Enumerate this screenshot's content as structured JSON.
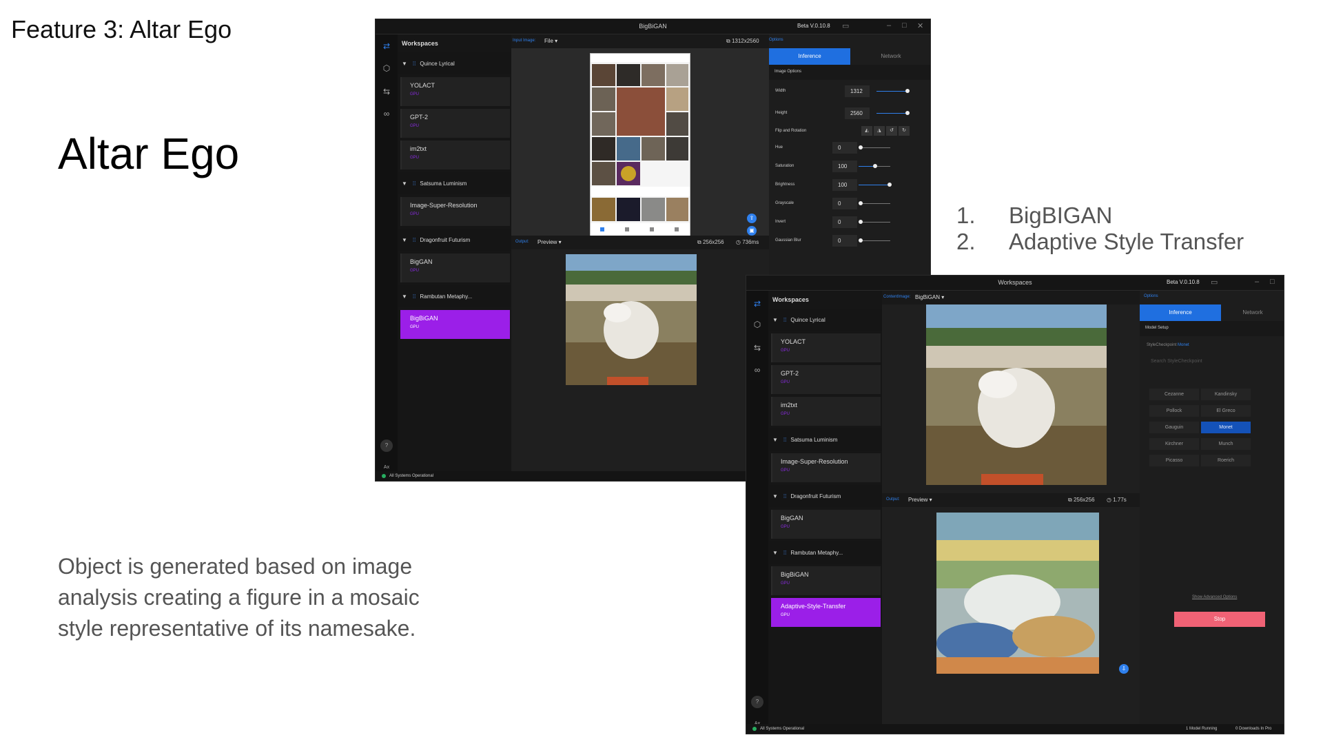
{
  "slide": {
    "feature": "Feature 3: Altar Ego",
    "title": "Altar Ego",
    "description": "Object is generated based on image analysis creating a figure in a mosaic style representative of its namesake.",
    "list": [
      {
        "num": "1.",
        "text": "BigBIGAN"
      },
      {
        "num": "2.",
        "text": "Adaptive Style Transfer"
      }
    ]
  },
  "win1": {
    "title": "BigBiGAN",
    "version": "Beta V.0.10.8",
    "workspaces_label": "Workspaces",
    "groups": [
      {
        "name": "Quince Lyrical",
        "items": [
          {
            "name": "YOLACT",
            "tag": "GPU"
          },
          {
            "name": "GPT-2",
            "tag": "GPU"
          },
          {
            "name": "im2txt",
            "tag": "GPU"
          }
        ]
      },
      {
        "name": "Satsuma Luminism",
        "items": [
          {
            "name": "Image-Super-Resolution",
            "tag": "GPU"
          }
        ]
      },
      {
        "name": "Dragonfruit Futurism",
        "items": [
          {
            "name": "BigGAN",
            "tag": "GPU"
          }
        ]
      },
      {
        "name": "Rambutan Metaphy...",
        "items": [
          {
            "name": "BigBiGAN",
            "tag": "GPU"
          }
        ]
      }
    ],
    "input_label": "Input Image:",
    "input_dd": "File",
    "input_dim": "1312x2560",
    "output_label": "Output:",
    "output_dd": "Preview",
    "output_dim": "256x256",
    "output_time": "736ms",
    "options_label": "Options",
    "tab_inference": "Inference",
    "tab_network": "Network",
    "section": "Image Options",
    "width_label": "Width",
    "width_value": "1312",
    "height_label": "Height",
    "height_value": "2560",
    "flip_label": "Flip and Rotation",
    "params": [
      {
        "label": "Hue",
        "value": "0",
        "level": 0
      },
      {
        "label": "Saturation",
        "value": "100",
        "level": 0.5
      },
      {
        "label": "Brightness",
        "value": "100",
        "level": 1
      },
      {
        "label": "Grayscale",
        "value": "0",
        "level": 0
      },
      {
        "label": "Invert",
        "value": "0",
        "level": 0
      },
      {
        "label": "Gaussian Blur",
        "value": "0",
        "level": 0
      }
    ],
    "status": "All Systems Operational",
    "help_icon": "?",
    "avatar": "Ax"
  },
  "win2": {
    "title": "Workspaces",
    "version": "Beta V.0.10.8",
    "workspaces_label": "Workspaces",
    "groups": [
      {
        "name": "Quince Lyrical",
        "items": [
          {
            "name": "YOLACT",
            "tag": "GPU"
          },
          {
            "name": "GPT-2",
            "tag": "GPU"
          },
          {
            "name": "im2txt",
            "tag": "GPU"
          }
        ]
      },
      {
        "name": "Satsuma Luminism",
        "items": [
          {
            "name": "Image-Super-Resolution",
            "tag": "GPU"
          }
        ]
      },
      {
        "name": "Dragonfruit Futurism",
        "items": [
          {
            "name": "BigGAN",
            "tag": "GPU"
          }
        ]
      },
      {
        "name": "Rambutan Metaphy...",
        "items": [
          {
            "name": "BigBiGAN",
            "tag": "GPU"
          },
          {
            "name": "Adaptive-Style-Transfer",
            "tag": "GPU"
          }
        ]
      }
    ],
    "input_label": "ContentImage:",
    "input_dd": "BigBiGAN",
    "output_label": "Output:",
    "output_dd": "Preview",
    "output_dim": "256x256",
    "output_time": "1.77s",
    "options_label": "Options",
    "tab_inference": "Inference",
    "tab_network": "Network",
    "section": "Model Setup",
    "checkpoint_label": "StyleCheckpoint",
    "checkpoint_value": "Monet",
    "search_placeholder": "Search StyleCheckpoint",
    "styles": [
      "Cezanne",
      "Kandinsky",
      "Pollock",
      "El Greco",
      "Gauguin",
      "Monet",
      "Kirchner",
      "Munch",
      "Picasso",
      "Roerich"
    ],
    "selected_style": "Monet",
    "advanced": "Show Advanced Options",
    "stop": "Stop",
    "status": "All Systems Operational",
    "running": "1 Model Running",
    "downloads": "0 Downloads In Pro",
    "help_icon": "?",
    "avatar": "Ax"
  },
  "colors": {
    "accent_purple": "#9b1fe8",
    "accent_blue": "#1f6fe0",
    "stop_red": "#f06275",
    "status_green": "#27ae60"
  }
}
